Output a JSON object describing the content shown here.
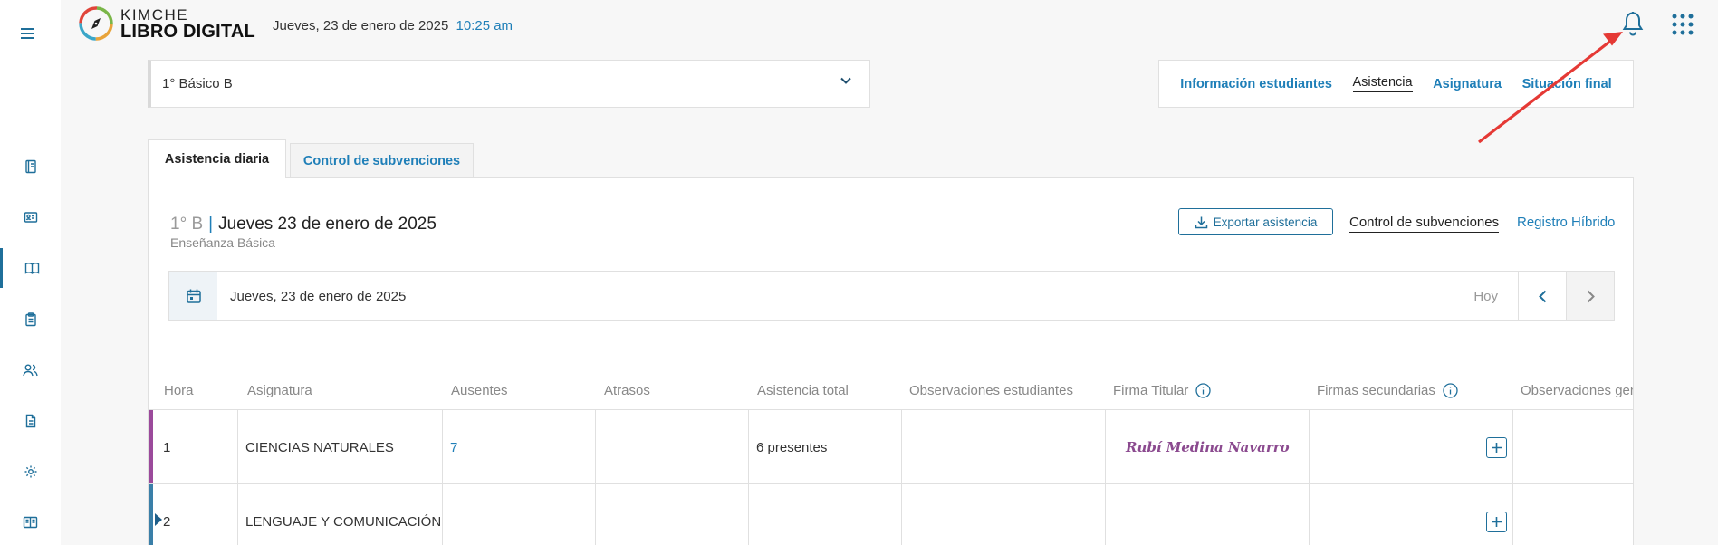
{
  "header": {
    "logo_top": "KIMCHE",
    "logo_bottom": "LIBRO DIGITAL",
    "date": "Jueves, 23 de enero de 2025",
    "time": "10:25 am"
  },
  "sidebar": {
    "items": [
      {
        "icon": "book-log-icon"
      },
      {
        "icon": "id-card-icon"
      },
      {
        "icon": "open-book-icon",
        "active": true
      },
      {
        "icon": "clipboard-icon"
      },
      {
        "icon": "users-icon"
      },
      {
        "icon": "document-icon"
      },
      {
        "icon": "gear-icon"
      },
      {
        "icon": "reader-icon"
      }
    ]
  },
  "course_select": {
    "value": "1° Básico B"
  },
  "nav_tabs": [
    {
      "label": "Información estudiantes",
      "active": false
    },
    {
      "label": "Asistencia",
      "active": true
    },
    {
      "label": "Asignatura",
      "active": false
    },
    {
      "label": "Situación final",
      "active": false
    }
  ],
  "subtabs": {
    "active": "Asistencia diaria",
    "inactive": "Control de subvenciones"
  },
  "card": {
    "grade": "1° B",
    "separator": "|",
    "title_date": "Jueves 23 de enero de 2025",
    "subtitle": "Enseñanza Básica",
    "export_label": "Exportar asistencia",
    "link_control": "Control de subvenciones",
    "link_hybrid": "Registro Híbrido"
  },
  "datebar": {
    "date": "Jueves, 23 de enero de 2025",
    "today": "Hoy"
  },
  "table": {
    "headers": [
      "Hora",
      "Asignatura",
      "Ausentes",
      "Atrasos",
      "Asistencia total",
      "Observaciones estudiantes",
      "Firma Titular",
      "Firmas secundarias",
      "Observaciones generales"
    ],
    "rows": [
      {
        "hora": "1",
        "asignatura": "CIENCIAS NATURALES",
        "ausentes": "7",
        "atrasos": "",
        "asistencia": "6 presentes",
        "observaciones": "",
        "firma": "Rubí Medina Navarro",
        "color": "#9b4a9b"
      },
      {
        "hora": "2",
        "asignatura": "LENGUAJE Y COMUNICACIÓN",
        "ausentes": "",
        "atrasos": "",
        "asistencia": "",
        "observaciones": "",
        "firma": "",
        "color": "#3a7fa8"
      }
    ]
  },
  "colors": {
    "accent": "#1f7fb8",
    "annotation_arrow": "#e53935"
  }
}
